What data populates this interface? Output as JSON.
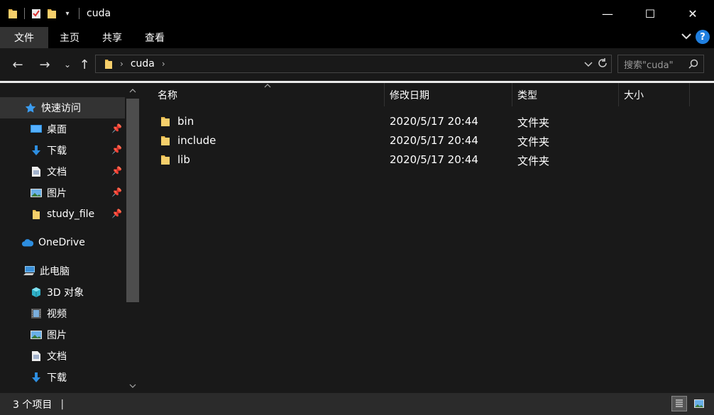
{
  "window": {
    "title": "cuda",
    "min": "—",
    "max": "☐",
    "close": "✕"
  },
  "ribbon": {
    "tabs": [
      "文件",
      "主页",
      "共享",
      "查看"
    ]
  },
  "nav": {
    "back": "←",
    "forward": "→",
    "recent": "⌄",
    "up": "↑",
    "path_segment": "cuda",
    "search_placeholder": "搜索\"cuda\""
  },
  "sidebar": {
    "quick_access": "快速访问",
    "pinned": [
      {
        "label": "桌面",
        "icon": "desktop-icon"
      },
      {
        "label": "下载",
        "icon": "download-icon"
      },
      {
        "label": "文档",
        "icon": "document-icon"
      },
      {
        "label": "图片",
        "icon": "pictures-icon"
      },
      {
        "label": "study_file",
        "icon": "folder-icon"
      }
    ],
    "onedrive": "OneDrive",
    "this_pc": "此电脑",
    "pc_items": [
      {
        "label": "3D 对象",
        "icon": "3d-objects-icon"
      },
      {
        "label": "视频",
        "icon": "video-icon"
      },
      {
        "label": "图片",
        "icon": "pictures-icon"
      },
      {
        "label": "文档",
        "icon": "document-icon"
      },
      {
        "label": "下载",
        "icon": "download-icon"
      }
    ]
  },
  "columns": {
    "name": "名称",
    "modified": "修改日期",
    "type": "类型",
    "size": "大小"
  },
  "files": [
    {
      "name": "bin",
      "modified": "2020/5/17 20:44",
      "type": "文件夹"
    },
    {
      "name": "include",
      "modified": "2020/5/17 20:44",
      "type": "文件夹"
    },
    {
      "name": "lib",
      "modified": "2020/5/17 20:44",
      "type": "文件夹"
    }
  ],
  "status": {
    "count": "3 个项目",
    "separator": "|"
  },
  "colors": {
    "folder": "#e8b84a",
    "accent": "#1f7fe0",
    "background": "#191919"
  }
}
